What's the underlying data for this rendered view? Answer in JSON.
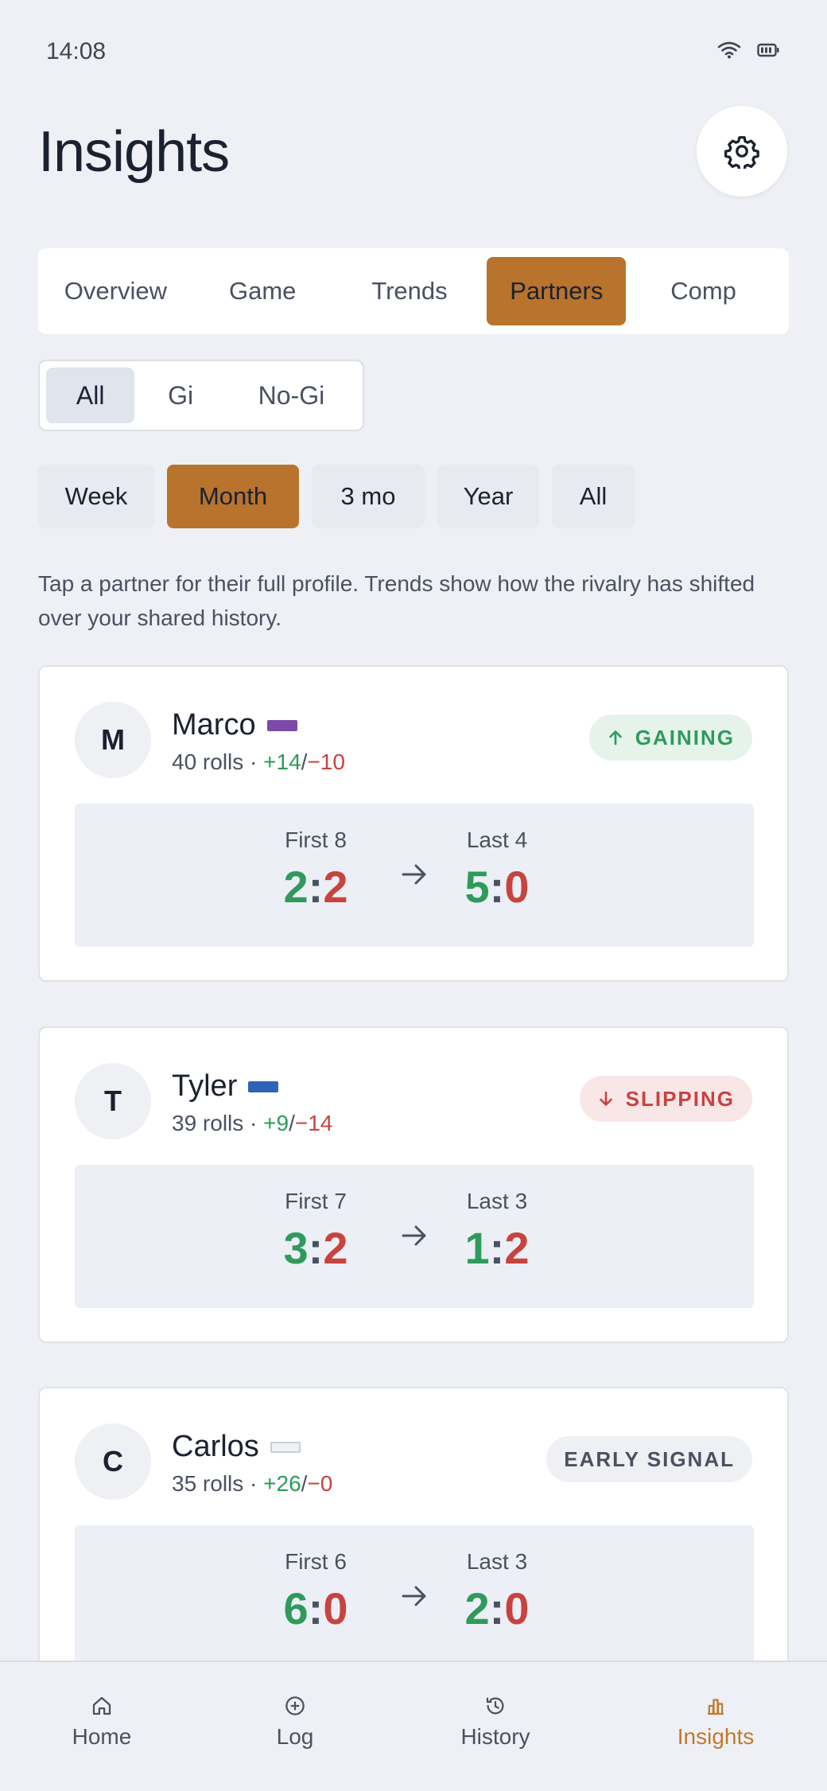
{
  "status_bar": {
    "time": "14:08"
  },
  "header": {
    "title": "Insights"
  },
  "tabs": [
    "Overview",
    "Game",
    "Trends",
    "Partners",
    "Comp"
  ],
  "active_tab": "Partners",
  "filter": {
    "options": [
      "All",
      "Gi",
      "No-Gi"
    ],
    "selected": "All"
  },
  "periods": {
    "options": [
      "Week",
      "Month",
      "3 mo",
      "Year",
      "All"
    ],
    "selected": "Month"
  },
  "hint": "Tap a partner for their full profile. Trends show how the rivalry has shifted over your shared history.",
  "partners": [
    {
      "initial": "M",
      "name": "Marco",
      "belt_color": "#7b4aa8",
      "rolls": "40 rolls",
      "wins": "+14",
      "losses": "−10",
      "badge": "GAINING",
      "badge_icon": "arrow-up-icon",
      "first_label": "First 8",
      "first_w": "2",
      "first_l": "2",
      "last_label": "Last 4",
      "last_w": "5",
      "last_l": "0"
    },
    {
      "initial": "T",
      "name": "Tyler",
      "belt_color": "#2f63b5",
      "rolls": "39 rolls",
      "wins": "+9",
      "losses": "−14",
      "badge": "SLIPPING",
      "badge_icon": "arrow-down-icon",
      "first_label": "First 7",
      "first_w": "3",
      "first_l": "2",
      "last_label": "Last 3",
      "last_w": "1",
      "last_l": "2"
    },
    {
      "initial": "C",
      "name": "Carlos",
      "belt_color": "#eef0f3",
      "rolls": "35 rolls",
      "wins": "+26",
      "losses": "−0",
      "badge": "EARLY SIGNAL",
      "badge_icon": "",
      "first_label": "First 6",
      "first_w": "6",
      "first_l": "0",
      "last_label": "Last 3",
      "last_w": "2",
      "last_l": "0"
    }
  ],
  "bottom_nav": [
    {
      "label": "Home",
      "icon": "home-icon"
    },
    {
      "label": "Log",
      "icon": "plus-circle-icon"
    },
    {
      "label": "History",
      "icon": "history-icon"
    },
    {
      "label": "Insights",
      "icon": "bar-chart-icon"
    }
  ],
  "colors": {
    "accent": "#b8732c",
    "win": "#2f9a5c",
    "loss": "#c7433f"
  }
}
